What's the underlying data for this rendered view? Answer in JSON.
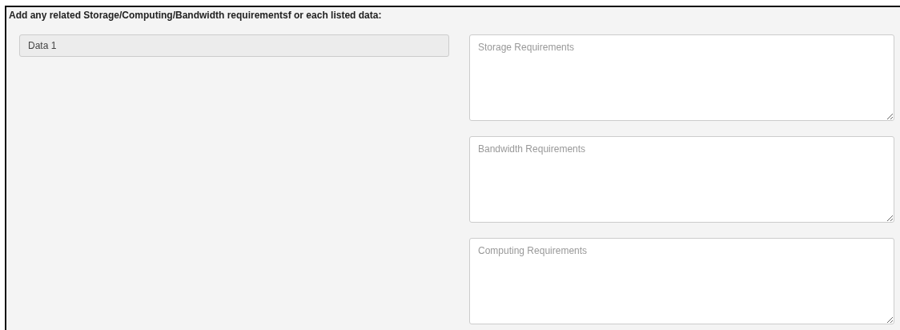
{
  "heading": "Add any related Storage/Computing/Bandwidth requirementsf or each listed data:",
  "data_items": [
    {
      "value": "Data 1"
    }
  ],
  "requirements": [
    {
      "placeholder": "Storage Requirements"
    },
    {
      "placeholder": "Bandwidth Requirements"
    },
    {
      "placeholder": "Computing Requirements"
    }
  ]
}
